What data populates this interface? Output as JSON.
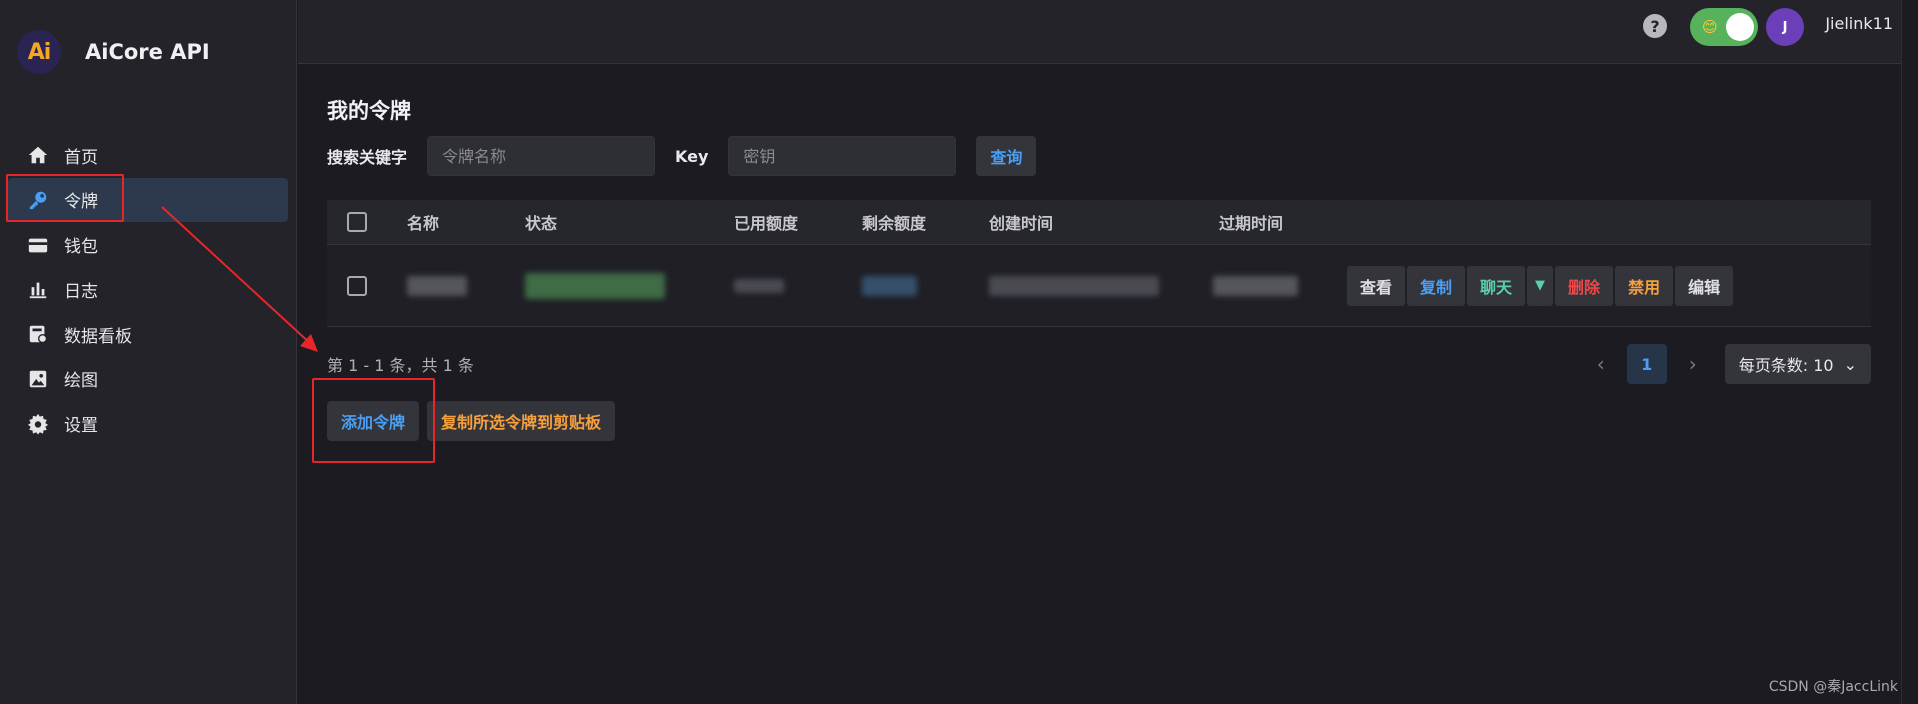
{
  "app": {
    "name": "AiCore API",
    "logo_text": "Ai"
  },
  "sidebar": {
    "items": [
      {
        "label": "首页",
        "icon": "home-icon",
        "active": false
      },
      {
        "label": "令牌",
        "icon": "key-icon",
        "active": true
      },
      {
        "label": "钱包",
        "icon": "wallet-icon",
        "active": false
      },
      {
        "label": "日志",
        "icon": "bar-chart-icon",
        "active": false
      },
      {
        "label": "数据看板",
        "icon": "dashboard-icon",
        "active": false
      },
      {
        "label": "绘图",
        "icon": "image-icon",
        "active": false
      },
      {
        "label": "设置",
        "icon": "gear-icon",
        "active": false
      }
    ]
  },
  "topbar": {
    "help_icon": "?",
    "theme_toggle_emoji": "😊",
    "avatar_initial": "J",
    "username": "Jielink11"
  },
  "main": {
    "title": "我的令牌",
    "search": {
      "keyword_label": "搜索关键字",
      "keyword_placeholder": "令牌名称",
      "key_label": "Key",
      "key_placeholder": "密钥",
      "query_label": "查询"
    },
    "table": {
      "columns": [
        "名称",
        "状态",
        "已用额度",
        "剩余额度",
        "创建时间",
        "过期时间"
      ],
      "row_actions": [
        "查看",
        "复制",
        "聊天",
        "删除",
        "禁用",
        "编辑"
      ]
    },
    "pagination": {
      "summary": "第 1 - 1 条，共 1 条",
      "current_page": "1",
      "page_size_label": "每页条数: 10"
    },
    "buttons": {
      "add_token": "添加令牌",
      "copy_selected": "复制所选令牌到剪贴板"
    }
  },
  "watermark": "CSDN @秦JaccLink",
  "colors": {
    "accent_blue": "#4a9ff5",
    "accent_orange": "#f5a03c",
    "danger_red": "#f0484a",
    "success_green": "#58d0a8",
    "annotation_red": "#e8262a"
  }
}
